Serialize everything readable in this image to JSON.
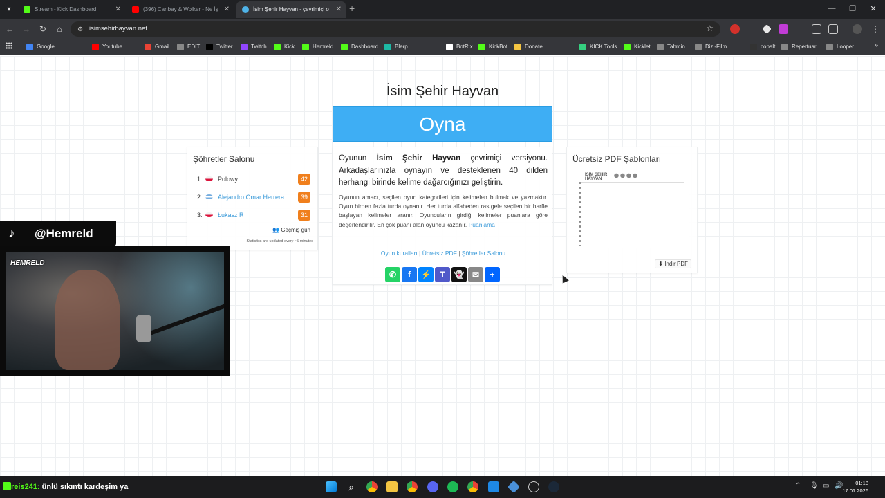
{
  "browser": {
    "tabs": [
      {
        "title": "Stream - Kick Dashboard",
        "color": "#53fc18"
      },
      {
        "title": "(396) Canbay & Wolker - Ne İş",
        "color": "#ff0000"
      },
      {
        "title": "İsim Şehir Hayvan - çevrimiçi o",
        "color": "#4fb3e8"
      }
    ],
    "url": "isimsehirhayvan.net",
    "bookmarks": [
      "Google",
      "Youtube",
      "Gmail",
      "EDİT",
      "Twitter",
      "Twitch",
      "Kick",
      "Hemreld",
      "Dashboard",
      "Blerp",
      "BotRix",
      "KickBot",
      "Donate",
      "KICK Tools",
      "Kicklet",
      "Tahmin",
      "Dizi-Film",
      "cobalt",
      "Repertuar",
      "Looper"
    ]
  },
  "page": {
    "title": "İsim Şehir Hayvan",
    "play_button": "Oyna",
    "hall_of_fame": {
      "title": "Şöhretler Salonu",
      "entries": [
        {
          "rank": "1.",
          "name": "Polowy",
          "score": "42"
        },
        {
          "rank": "2.",
          "name": "Alejandro Omar Herrera",
          "score": "39"
        },
        {
          "rank": "3.",
          "name": "Łukasz R",
          "score": "31"
        }
      ],
      "past_days": "Geçmiş gün",
      "note": "Statistics are updated every ~5 minutes"
    },
    "intro": {
      "p1_prefix": "Oyunun ",
      "p1_bold": "İsim Şehir Hayvan",
      "p1_suffix": " çevrimiçi versiyonu. Arkadaşlarınızla oynayın ve desteklenen 40 dilden herhangi birinde kelime dağarcığınızı geliştirin.",
      "p2": "Oyunun amacı, seçilen oyun kategorileri için kelimelen bulmak ve yazmaktır. Oyun birden fazla turda oynanır. Her turda alfabeden rastgele seçilen bir harfle başlayan kelimeler aranır. Oyuncuların girdiği kelimeler puanlara göre değerlendirilir. En çok puanı alan oyuncu kazanır.",
      "p2_link": "Puanlama",
      "links": [
        "Oyun kuralları",
        "Ücretsiz PDF",
        "Şöhretler Salonu"
      ],
      "separator": "|"
    },
    "share_icons": [
      {
        "name": "whatsapp-icon",
        "color": "#25d366",
        "glyph": "✆"
      },
      {
        "name": "facebook-icon",
        "color": "#1877f2",
        "glyph": "f"
      },
      {
        "name": "messenger-icon",
        "color": "#0084ff",
        "glyph": "⚡"
      },
      {
        "name": "teams-icon",
        "color": "#5059c9",
        "glyph": "T"
      },
      {
        "name": "snapchat-icon",
        "color": "#111111",
        "glyph": "👻"
      },
      {
        "name": "email-icon",
        "color": "#888888",
        "glyph": "✉"
      },
      {
        "name": "share-icon",
        "color": "#0166ff",
        "glyph": "+"
      }
    ],
    "pdf": {
      "title": "Ücretsiz PDF Şablonları",
      "thumb_title": "İSİM ŞEHİR HAYVAN",
      "download": "İndir PDF"
    }
  },
  "stream": {
    "tiktok_handle": "@Hemreld",
    "cam_logo": "HEMRELD",
    "chat_user": "reis241:",
    "chat_message": " ünlü sıkıntı kardeşim ya"
  },
  "taskbar": {
    "time": "01:18",
    "date": "17.01.2026"
  }
}
